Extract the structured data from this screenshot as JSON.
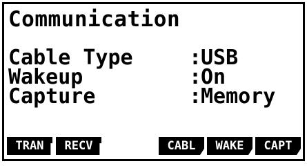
{
  "screen": {
    "title": "Communication",
    "settings": [
      {
        "label": "Cable Type",
        "value": "USB"
      },
      {
        "label": "Wakeup",
        "value": "On"
      },
      {
        "label": "Capture",
        "value": "Memory"
      }
    ],
    "separator": ":"
  },
  "function_keys": [
    {
      "label": "TRAN"
    },
    {
      "label": "RECV"
    },
    {
      "label": ""
    },
    {
      "label": "CABL"
    },
    {
      "label": "WAKE"
    },
    {
      "label": "CAPT"
    }
  ]
}
